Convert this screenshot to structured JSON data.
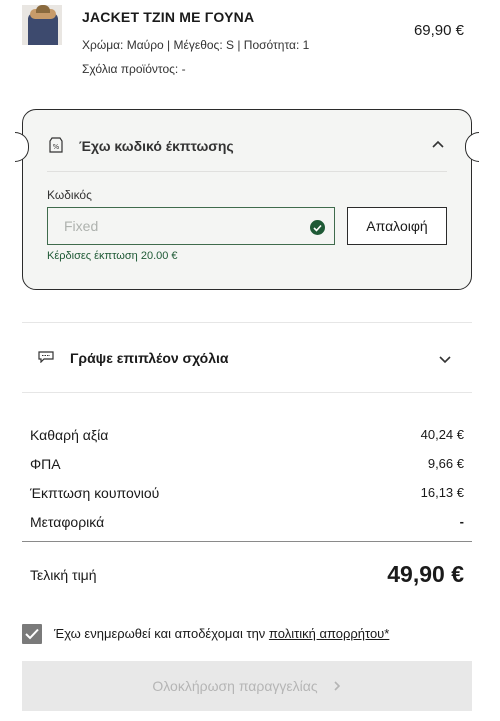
{
  "product": {
    "name": "JACKET ΤΖΙΝ ΜΕ ΓΟΥΝΑ",
    "price": "69,90 €",
    "meta": "Χρώμα: Μαύρο | Μέγεθος: S | Ποσότητα: 1",
    "comment": "Σχόλια προϊόντος: -"
  },
  "coupon": {
    "title": "Έχω κωδικό έκπτωσης",
    "code_label": "Κωδικός",
    "code_value": "",
    "code_placeholder": "Fixed",
    "clear_label": "Απαλοιφή",
    "discount_message": "Κέρδισες έκπτωση 20.00 €",
    "icons": {
      "tag": "discount-tag-icon",
      "toggle": "chevron-up-icon",
      "status": "check-circle-icon"
    },
    "success_color": "#1f5a36"
  },
  "comments": {
    "title": "Γράψε επιπλέον σχόλια",
    "icons": {
      "lead": "chat-icon",
      "toggle": "chevron-down-icon"
    }
  },
  "summary": {
    "rows": [
      {
        "label": "Καθαρή αξία",
        "value": "40,24 €"
      },
      {
        "label": "ΦΠΑ",
        "value": "9,66 €"
      },
      {
        "label": "Έκπτωση κουπονιού",
        "value": "16,13 €"
      },
      {
        "label": "Μεταφορικά",
        "value": "-"
      }
    ],
    "total_label": "Τελική τιμή",
    "total_value": "49,90 €"
  },
  "terms": {
    "text": "Έχω ενημερωθεί και αποδέχομαι την ",
    "link": "πολιτική απορρήτου*",
    "checked": true
  },
  "submit": {
    "label": "Ολοκλήρωση παραγγελίας",
    "enabled": false
  }
}
